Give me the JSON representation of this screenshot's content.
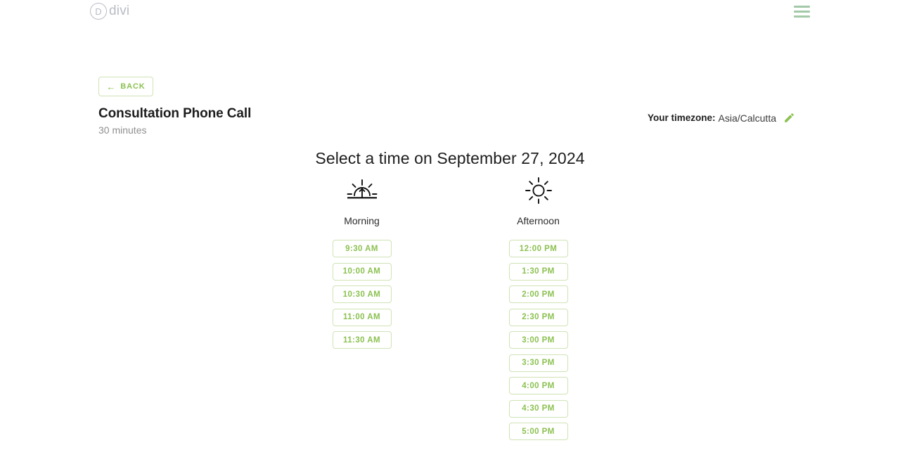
{
  "header": {
    "brand_mark": "D",
    "brand_word": "divi",
    "menu_icon": "hamburger-menu-icon"
  },
  "nav": {
    "back_label": "BACK",
    "back_arrow_glyph": "←"
  },
  "event": {
    "title": "Consultation Phone Call",
    "duration": "30 minutes"
  },
  "timezone": {
    "label": "Your timezone:",
    "value": "Asia/Calcutta",
    "edit_icon": "pencil-edit-icon"
  },
  "main": {
    "heading": "Select a time on September 27, 2024"
  },
  "colors": {
    "accent_green": "#8cc152",
    "border_green": "#cfe3b4",
    "menu_green": "#a3c9a8",
    "brand_gray": "#b9bcc4",
    "text_dark": "#1d1d1d",
    "text_muted": "#8f8f8f"
  },
  "columns": [
    {
      "key": "morning",
      "label": "Morning",
      "icon": "sunrise-icon",
      "slots": [
        "9:30 AM",
        "10:00 AM",
        "10:30 AM",
        "11:00 AM",
        "11:30 AM"
      ]
    },
    {
      "key": "afternoon",
      "label": "Afternoon",
      "icon": "sun-icon",
      "slots": [
        "12:00 PM",
        "1:30 PM",
        "2:00 PM",
        "2:30 PM",
        "3:00 PM",
        "3:30 PM",
        "4:00 PM",
        "4:30 PM",
        "5:00 PM"
      ]
    }
  ]
}
